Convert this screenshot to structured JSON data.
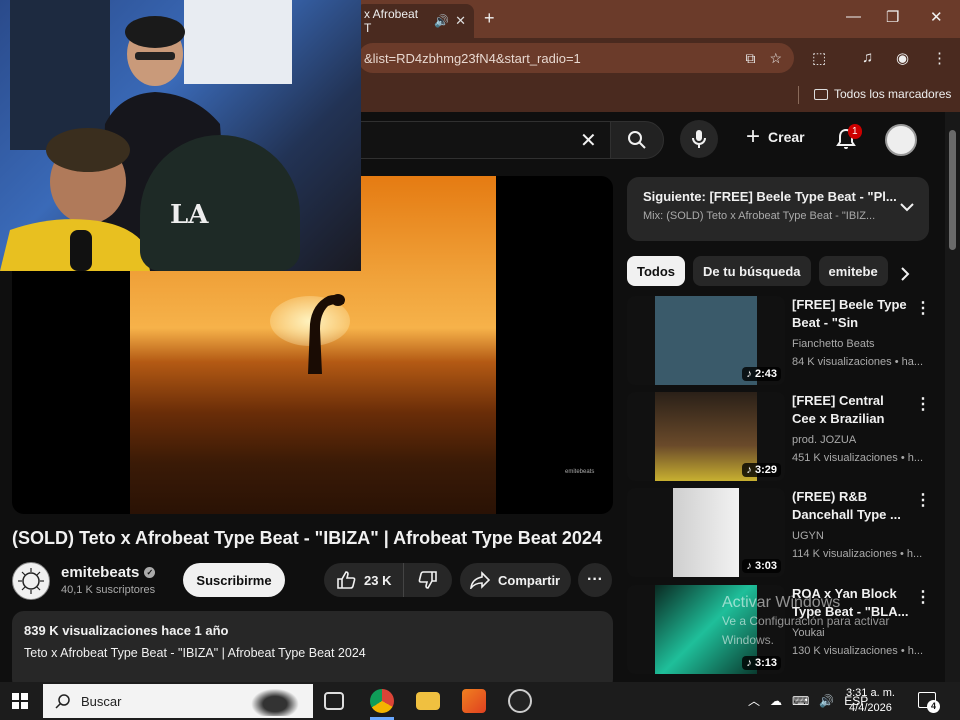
{
  "browser": {
    "tab_title": "x Afrobeat T",
    "url": "&list=RD4zbhmg23fN4&start_radio=1",
    "bookmarks_label": "Todos los marcadores"
  },
  "header": {
    "create_label": "Crear",
    "notification_count": "1"
  },
  "video": {
    "title": "(SOLD) Teto x Afrobeat Type Beat - \"IBIZA\" | Afrobeat Type Beat 2024",
    "watermark": "emitebeats",
    "channel_name": "emitebeats",
    "channel_subs": "40,1 K suscriptores",
    "subscribe_label": "Suscribirme",
    "likes": "23 K",
    "share_label": "Compartir",
    "description_stats": "839 K visualizaciones  hace 1 año",
    "description_text": "Teto x Afrobeat Type Beat - \"IBIZA\" | Afrobeat Type Beat 2024"
  },
  "webcam": {
    "cap_text": "LA"
  },
  "upnext": {
    "title": "Siguiente: [FREE] Beele Type Beat - \"Pl...",
    "subtitle": "Mix: (SOLD) Teto x Afrobeat Type Beat - \"IBIZ..."
  },
  "chips": [
    "Todos",
    "De tu búsqueda",
    "emitebe"
  ],
  "recommendations": [
    {
      "title": "[FREE] Beele Type Beat - \"Sin Pensa...",
      "channel": "Fianchetto Beats",
      "views": "84 K visualizaciones • ha...",
      "duration": "2:43",
      "thumb_color": "#3a5a6a"
    },
    {
      "title": "[FREE] Central Cee x Brazilian Funk ...",
      "channel": "prod. JOZUA",
      "views": "451 K visualizaciones • h...",
      "duration": "3:29",
      "thumb_color": "#3a2a1a"
    },
    {
      "title": "(FREE) R&B Dancehall Type ...",
      "channel": "UGYN",
      "views": "114 K visualizaciones • h...",
      "duration": "3:03",
      "thumb_color": "#d8d8d8"
    },
    {
      "title": "ROA x Yan Block Type Beat - \"BLA...",
      "channel": "Youkai",
      "views": "130 K visualizaciones • h...",
      "duration": "3:13",
      "thumb_color": "#1fbf9a"
    }
  ],
  "activation": {
    "title": "Activar Windows",
    "subtitle": "Ve a Configuración para activar Windows."
  },
  "taskbar": {
    "search_label": "Buscar",
    "language": "ESP",
    "time": "3:31 a. m.",
    "date": "4/4/2026",
    "notification_count": "4"
  }
}
